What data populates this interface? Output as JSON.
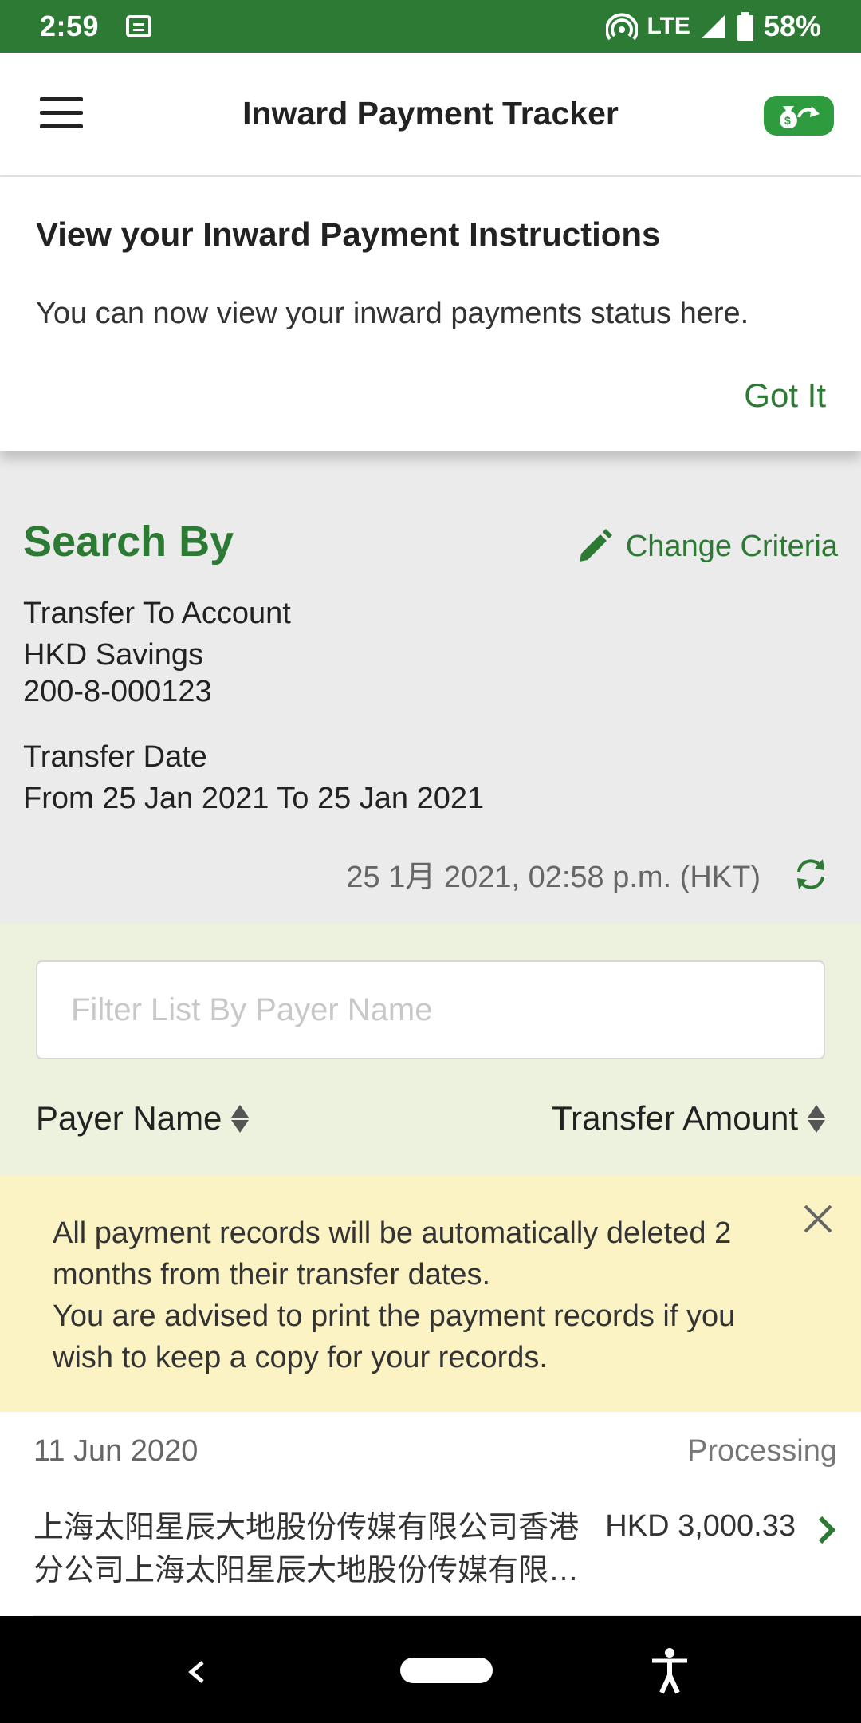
{
  "status_bar": {
    "time": "2:59",
    "network": "LTE",
    "battery": "58%"
  },
  "header": {
    "title": "Inward Payment Tracker",
    "colors": {
      "accent": "#2d7a35",
      "button_bg": "#2e9c3e"
    }
  },
  "intro_card": {
    "title": "View your Inward Payment Instructions",
    "text": "You can now view your inward payments status here.",
    "button": "Got It"
  },
  "search": {
    "heading": "Search By",
    "change_criteria": "Change Criteria",
    "account_label": "Transfer To Account",
    "account_name": "HKD Savings",
    "account_number": "200-8-000123",
    "date_label": "Transfer Date",
    "date_range": "From 25 Jan 2021 To 25 Jan 2021",
    "timestamp": "25 1月 2021, 02:58 p.m. (HKT)"
  },
  "filter": {
    "placeholder": "Filter List By Payer Name",
    "col_payer": "Payer Name",
    "col_amount": "Transfer Amount"
  },
  "notice": {
    "line1": "All payment records will be automatically deleted 2 months from their transfer dates.",
    "line2": "You are advised to print the payment records if you wish to keep a copy for your records."
  },
  "records": [
    {
      "date": "11 Jun 2020",
      "status": "Processing",
      "payer": "上海太阳星辰大地股份传媒有限公司香港分公司上海太阳星辰大地股份传媒有限公司",
      "amount": "HKD 3,000.33"
    }
  ]
}
